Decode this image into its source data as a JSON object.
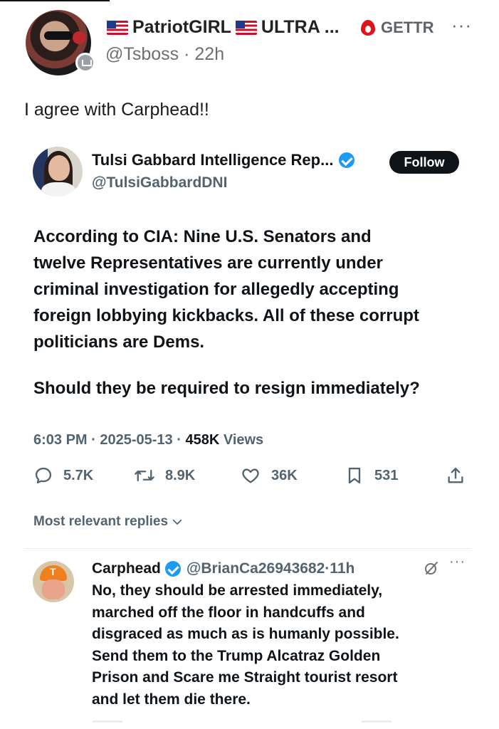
{
  "gettr_post": {
    "display_name": "PatriotGIRL",
    "name_suffix": "ULTRA ...",
    "handle": "@Tsboss",
    "time_ago": "22h",
    "brand": "GETTR",
    "more": "···",
    "text": "I agree with Carphead!!"
  },
  "quoted_tweet": {
    "author_name": "Tulsi Gabbard Intelligence Rep...",
    "author_handle": "@TulsiGabbardDNI",
    "follow_label": "Follow",
    "body_lines": [
      "According to CIA: Nine U.S. Senators and",
      "twelve Representatives are currently under",
      "criminal investigation for allegedly accepting",
      "foreign lobbying kickbacks. All of these corrupt",
      "politicians are Dems."
    ],
    "question": "Should they be required to resign immediately?",
    "time": "6:03 PM",
    "date": "2025-05-13",
    "views_count": "458K",
    "views_label": "Views",
    "stats": {
      "replies": "5.7K",
      "retweets": "8.9K",
      "likes": "36K",
      "bookmarks": "531"
    },
    "replies_filter": "Most relevant replies"
  },
  "reply": {
    "author_name": "Carphead",
    "author_handle": "@BrianCa26943682",
    "time_ago": "11h",
    "more": "···",
    "body_lines": [
      "No, they should be arrested immediately,",
      "marched off the floor in handcuffs and",
      "disgraced as much as is humanly possible.",
      "Send them to the Trump Alcatraz Golden",
      "Prison and Scare me Straight tourist resort",
      "and let them die there."
    ]
  },
  "colors": {
    "verified_blue": "#1d9bf0",
    "gettr_red": "#e0121c",
    "text_dark": "#0f1419",
    "text_muted": "#536471"
  }
}
